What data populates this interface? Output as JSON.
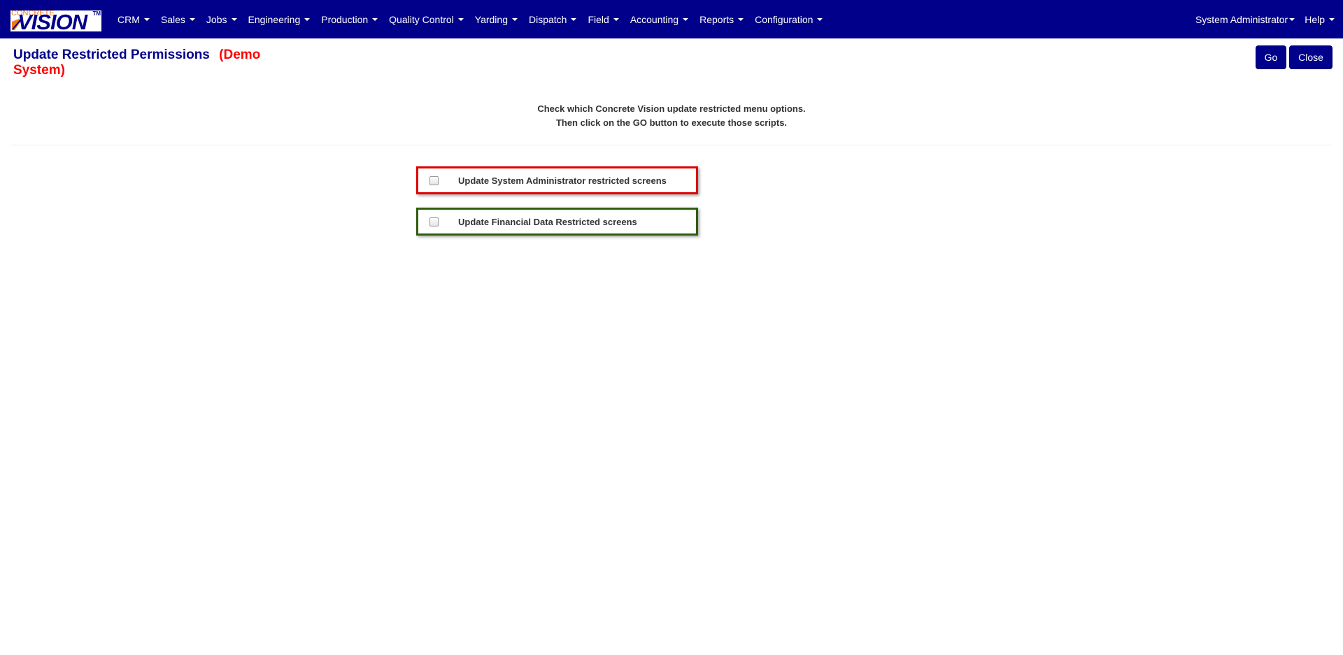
{
  "logo": {
    "small_text": "CONCRETE",
    "big_text": "VISION",
    "tm": "TM"
  },
  "nav": {
    "items": [
      {
        "label": "CRM"
      },
      {
        "label": "Sales"
      },
      {
        "label": "Jobs"
      },
      {
        "label": "Engineering"
      },
      {
        "label": "Production"
      },
      {
        "label": "Quality Control"
      },
      {
        "label": "Yarding"
      },
      {
        "label": "Dispatch"
      },
      {
        "label": "Field"
      },
      {
        "label": "Accounting"
      },
      {
        "label": "Reports"
      },
      {
        "label": "Configuration"
      }
    ],
    "user": "System Administrator",
    "help": "Help"
  },
  "header": {
    "title": "Update Restricted Permissions",
    "demo_label": "(Demo System)"
  },
  "toolbar": {
    "go_label": "Go",
    "close_label": "Close"
  },
  "instructions": {
    "line1": "Check which Concrete Vision update restricted menu options.",
    "line2": "Then click on the GO button to execute those scripts."
  },
  "options": [
    {
      "label": "Update System Administrator restricted screens",
      "checked": false,
      "border_color": "#e00000"
    },
    {
      "label": "Update Financial Data Restricted screens",
      "checked": false,
      "border_color": "#2e5e0e"
    }
  ],
  "colors": {
    "navbar": "#00008b",
    "title": "#00008b",
    "demo": "#ff0000",
    "logo_accent": "#f07a1a"
  }
}
